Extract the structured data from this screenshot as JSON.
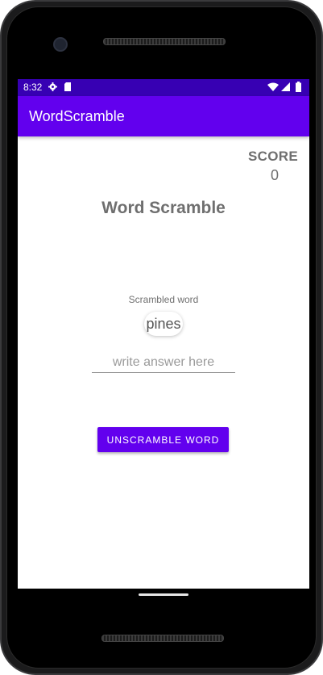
{
  "status_bar": {
    "time": "8:32",
    "icons": [
      "gear-icon",
      "sd-card-icon",
      "wifi-icon",
      "signal-icon",
      "battery-icon"
    ]
  },
  "app_bar": {
    "title": "WordScramble",
    "color": "#6200ee"
  },
  "score": {
    "label": "SCORE",
    "value": "0"
  },
  "game": {
    "title": "Word Scramble",
    "scrambled_label": "Scrambled word",
    "scrambled_word": "pines"
  },
  "answer": {
    "value": "",
    "placeholder": "write answer here"
  },
  "actions": {
    "unscramble_label": "UNSCRAMBLE WORD"
  },
  "colors": {
    "primary": "#6200ee",
    "primary_dark": "#3700b3",
    "text_secondary": "#6f6f6f"
  }
}
